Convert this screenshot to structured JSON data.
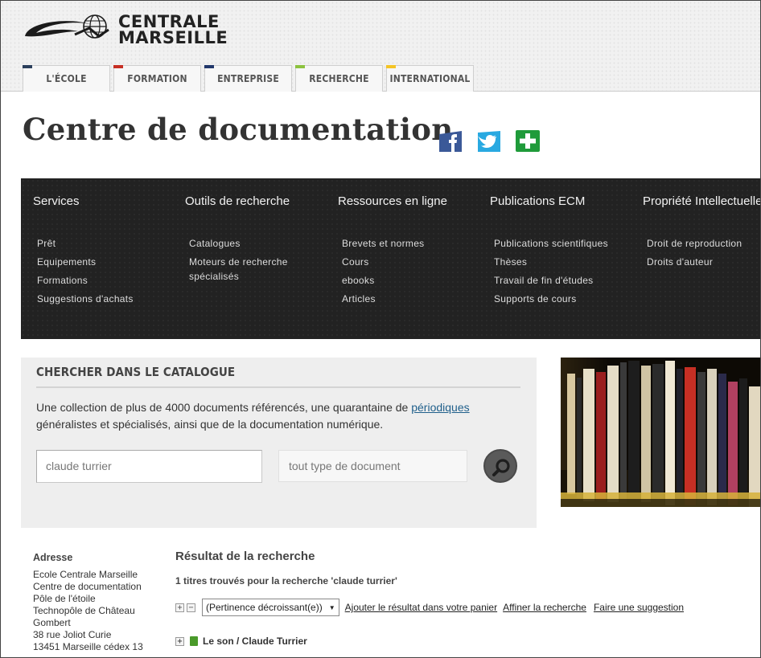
{
  "brand": {
    "name_line1": "CENTRALE",
    "name_line2": "MARSEILLE"
  },
  "colors": {
    "tab_ecole": "#2b3f5c",
    "tab_formation": "#c62f24",
    "tab_entreprise": "#22386b",
    "tab_recherche": "#8cc23f",
    "tab_international": "#f4c425"
  },
  "nav": {
    "tabs": [
      {
        "label": "L'ÉCOLE"
      },
      {
        "label": "FORMATION"
      },
      {
        "label": "ENTREPRISE"
      },
      {
        "label": "RECHERCHE"
      },
      {
        "label": "INTERNATIONAL"
      }
    ]
  },
  "page": {
    "title": "Centre de documentation"
  },
  "social": {
    "icons": [
      "facebook-icon",
      "twitter-icon",
      "share-plus-icon"
    ]
  },
  "menu": {
    "columns": [
      {
        "heading": "Services",
        "items": [
          "Prêt",
          "Equipements",
          "Formations",
          "Suggestions d'achats"
        ]
      },
      {
        "heading": "Outils de recherche",
        "items": [
          "Catalogues",
          "Moteurs de recherche",
          "spécialisés"
        ]
      },
      {
        "heading": "Ressources en ligne",
        "items": [
          "Brevets et normes",
          "Cours",
          "ebooks",
          "Articles"
        ]
      },
      {
        "heading": "Publications ECM",
        "items": [
          "Publications scientifiques",
          "Thèses",
          "Travail de fin d'études",
          "Supports de cours"
        ]
      },
      {
        "heading": "Propriété Intellectuelle",
        "items": [
          "Droit de reproduction",
          "Droits d'auteur"
        ]
      }
    ]
  },
  "search": {
    "title": "CHERCHER DANS LE CATALOGUE",
    "desc_before": "Une collection de plus de 4000 documents référencés, une quarantaine de ",
    "desc_link": "périodiques",
    "desc_after": " généralistes et spécialisés, ainsi que de la documentation numérique.",
    "query_value": "claude turrier",
    "type_value": "tout type de document"
  },
  "address": {
    "heading": "Adresse",
    "lines": [
      "Ecole Centrale Marseille",
      "Centre de documentation",
      "Pôle de l'étoile",
      "Technopôle de Château",
      "Gombert",
      "38 rue Joliot Curie",
      "13451 Marseille cédex 13"
    ]
  },
  "results": {
    "title": "Résultat de la recherche",
    "count_text": "1 titres trouvés pour la recherche 'claude turrier'",
    "expand_all": "+",
    "collapse_all": "−",
    "sort_value": "(Pertinence décroissant(e))",
    "actions": [
      "Ajouter le résultat dans votre panier",
      "Affiner la recherche",
      "Faire une suggestion"
    ],
    "items": [
      {
        "expand": "+",
        "title": "Le son / Claude Turrier"
      }
    ]
  }
}
